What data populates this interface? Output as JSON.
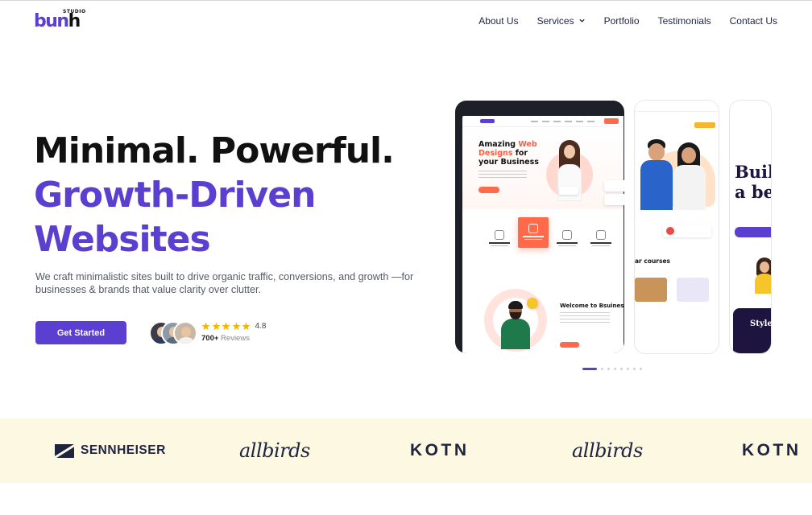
{
  "brand": {
    "logo_word_a": "bu",
    "logo_word_b": "n",
    "logo_word_c": "h",
    "logo_small": "STUDIO"
  },
  "nav": {
    "items": [
      "About Us",
      "Services",
      "Portfolio",
      "Testimonials",
      "Contact Us"
    ]
  },
  "hero": {
    "line1": "Minimal. Powerful.",
    "line2": "Growth-Driven",
    "line3": "Websites",
    "lede": "We craft minimalistic sites built to drive organic traffic, conversions, and growth —for businesses & brands that value clarity over clutter.",
    "cta": "Get Started",
    "rating": "4.8",
    "stars": 5,
    "reviews_count": "700+",
    "reviews_label": "Reviews"
  },
  "showcase": {
    "main": {
      "title_a": "Amazing ",
      "title_b": "Web",
      "title_c": "Designs",
      "title_d": " for",
      "title_e": "your Business",
      "welcome": "Welcome to Bsuiness"
    },
    "second": {
      "courses": "ar courses"
    },
    "third": {
      "build": "Buil",
      "build2": "a be",
      "styles": "Styles"
    },
    "carousel_total": 8,
    "carousel_active": 0
  },
  "partners": [
    "SENNHEISER",
    "allbirds",
    "KOTN",
    "allbirds",
    "KOTN"
  ],
  "colors": {
    "accent": "#5a3fd0",
    "strip_bg": "#fdf8e2",
    "star": "#f5b700",
    "mock_orange": "#ff6b4a"
  }
}
